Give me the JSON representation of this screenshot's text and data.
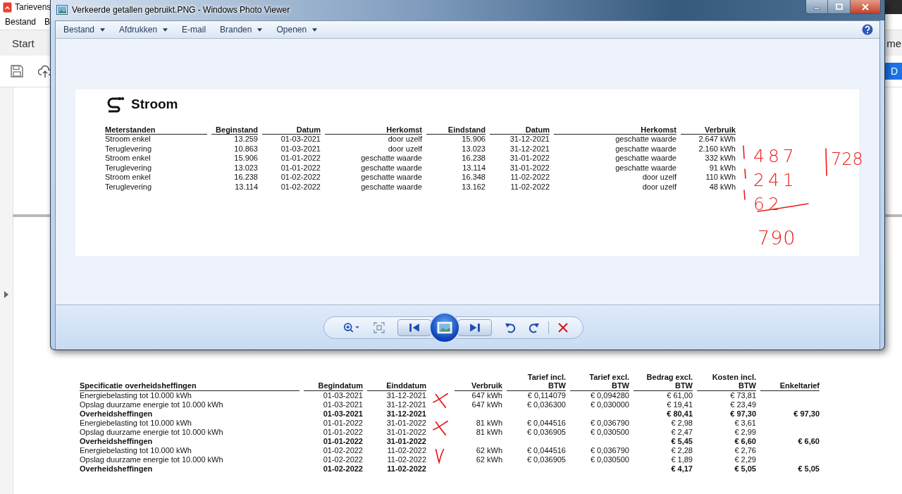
{
  "app": {
    "title": "Tarievens",
    "menu": [
      "Bestand",
      "B"
    ],
    "tab": "Start",
    "tab_right": "me",
    "action_button": "D"
  },
  "viewer": {
    "title": "Verkeerde getallen gebruikt.PNG - Windows Photo Viewer",
    "menu": [
      {
        "label": "Bestand",
        "dropdown": true
      },
      {
        "label": "Afdrukken",
        "dropdown": true
      },
      {
        "label": "E-mail",
        "dropdown": false
      },
      {
        "label": "Branden",
        "dropdown": true
      },
      {
        "label": "Openen",
        "dropdown": true
      }
    ],
    "image": {
      "heading": "Stroom",
      "columns": [
        "Meterstanden",
        "Beginstand",
        "Datum",
        "Herkomst",
        "Eindstand",
        "Datum",
        "Herkomst",
        "Verbruik"
      ],
      "rows": [
        [
          "Stroom enkel",
          "13.259",
          "01-03-2021",
          "door uzelf",
          "15.906",
          "31-12-2021",
          "geschatte waarde",
          "2.647 kWh"
        ],
        [
          "Teruglevering",
          "10.863",
          "01-03-2021",
          "door uzelf",
          "13.023",
          "31-12-2021",
          "geschatte waarde",
          "2.160 kWh"
        ],
        [
          "Stroom enkel",
          "15.906",
          "01-01-2022",
          "geschatte waarde",
          "16.238",
          "31-01-2022",
          "geschatte waarde",
          "332 kWh"
        ],
        [
          "Teruglevering",
          "13.023",
          "01-01-2022",
          "geschatte waarde",
          "13.114",
          "31-01-2022",
          "geschatte waarde",
          "91 kWh"
        ],
        [
          "Stroom enkel",
          "16.238",
          "01-02-2022",
          "geschatte waarde",
          "16.348",
          "11-02-2022",
          "door uzelf",
          "110 kWh"
        ],
        [
          "Teruglevering",
          "13.114",
          "01-02-2022",
          "geschatte waarde",
          "13.162",
          "11-02-2022",
          "door uzelf",
          "48 kWh"
        ]
      ],
      "handwriting": {
        "sums": [
          "487",
          "241",
          "62"
        ],
        "total": "790",
        "side_note": "728"
      }
    }
  },
  "specification": {
    "columns": [
      "Specificatie overheidsheffingen",
      "Begindatum",
      "Einddatum",
      "Verbruik",
      "Tarief incl. BTW",
      "Tarief excl. BTW",
      "Bedrag excl. BTW",
      "Kosten incl. BTW",
      "Enkeltarief"
    ],
    "groups": [
      {
        "kind": "cross",
        "rows": [
          {
            "description": "Energiebelasting tot 10.000 kWh",
            "start": "01-03-2021",
            "end": "31-12-2021",
            "usage": "647 kWh",
            "rate_incl": "€ 0,114079",
            "rate_excl": "€ 0,094280",
            "amount_excl": "€ 61,00",
            "cost_incl": "€ 73,81"
          },
          {
            "description": "Opslag duurzame energie tot 10.000 kWh",
            "start": "01-03-2021",
            "end": "31-12-2021",
            "usage": "647 kWh",
            "rate_incl": "€ 0,036300",
            "rate_excl": "€ 0,030000",
            "amount_excl": "€ 19,41",
            "cost_incl": "€ 23,49"
          }
        ],
        "total": {
          "label": "Overheidsheffingen",
          "start": "01-03-2021",
          "end": "31-12-2021",
          "amount_excl": "€ 80,41",
          "cost_incl": "€ 97,30",
          "single_rate": "€ 97,30"
        }
      },
      {
        "kind": "cross",
        "rows": [
          {
            "description": "Energiebelasting tot 10.000 kWh",
            "start": "01-01-2022",
            "end": "31-01-2022",
            "usage": "81 kWh",
            "rate_incl": "€ 0,044516",
            "rate_excl": "€ 0,036790",
            "amount_excl": "€ 2,98",
            "cost_incl": "€ 3,61"
          },
          {
            "description": "Opslag duurzame energie tot 10.000 kWh",
            "start": "01-01-2022",
            "end": "31-01-2022",
            "usage": "81 kWh",
            "rate_incl": "€ 0,036905",
            "rate_excl": "€ 0,030500",
            "amount_excl": "€ 2,47",
            "cost_incl": "€ 2,99"
          }
        ],
        "total": {
          "label": "Overheidsheffingen",
          "start": "01-01-2022",
          "end": "31-01-2022",
          "amount_excl": "€ 5,45",
          "cost_incl": "€ 6,60",
          "single_rate": "€ 6,60"
        }
      },
      {
        "kind": "check",
        "rows": [
          {
            "description": "Energiebelasting tot 10.000 kWh",
            "start": "01-02-2022",
            "end": "11-02-2022",
            "usage": "62 kWh",
            "rate_incl": "€ 0,044516",
            "rate_excl": "€ 0,036790",
            "amount_excl": "€ 2,28",
            "cost_incl": "€ 2,76"
          },
          {
            "description": "Opslag duurzame energie tot 10.000 kWh",
            "start": "01-02-2022",
            "end": "11-02-2022",
            "usage": "62 kWh",
            "rate_incl": "€ 0,036905",
            "rate_excl": "€ 0,030500",
            "amount_excl": "€ 1,89",
            "cost_incl": "€ 2,29"
          }
        ],
        "total": {
          "label": "Overheidsheffingen",
          "start": "01-02-2022",
          "end": "11-02-2022",
          "amount_excl": "€ 4,17",
          "cost_incl": "€ 5,05",
          "single_rate": "€ 5,05"
        }
      }
    ]
  }
}
